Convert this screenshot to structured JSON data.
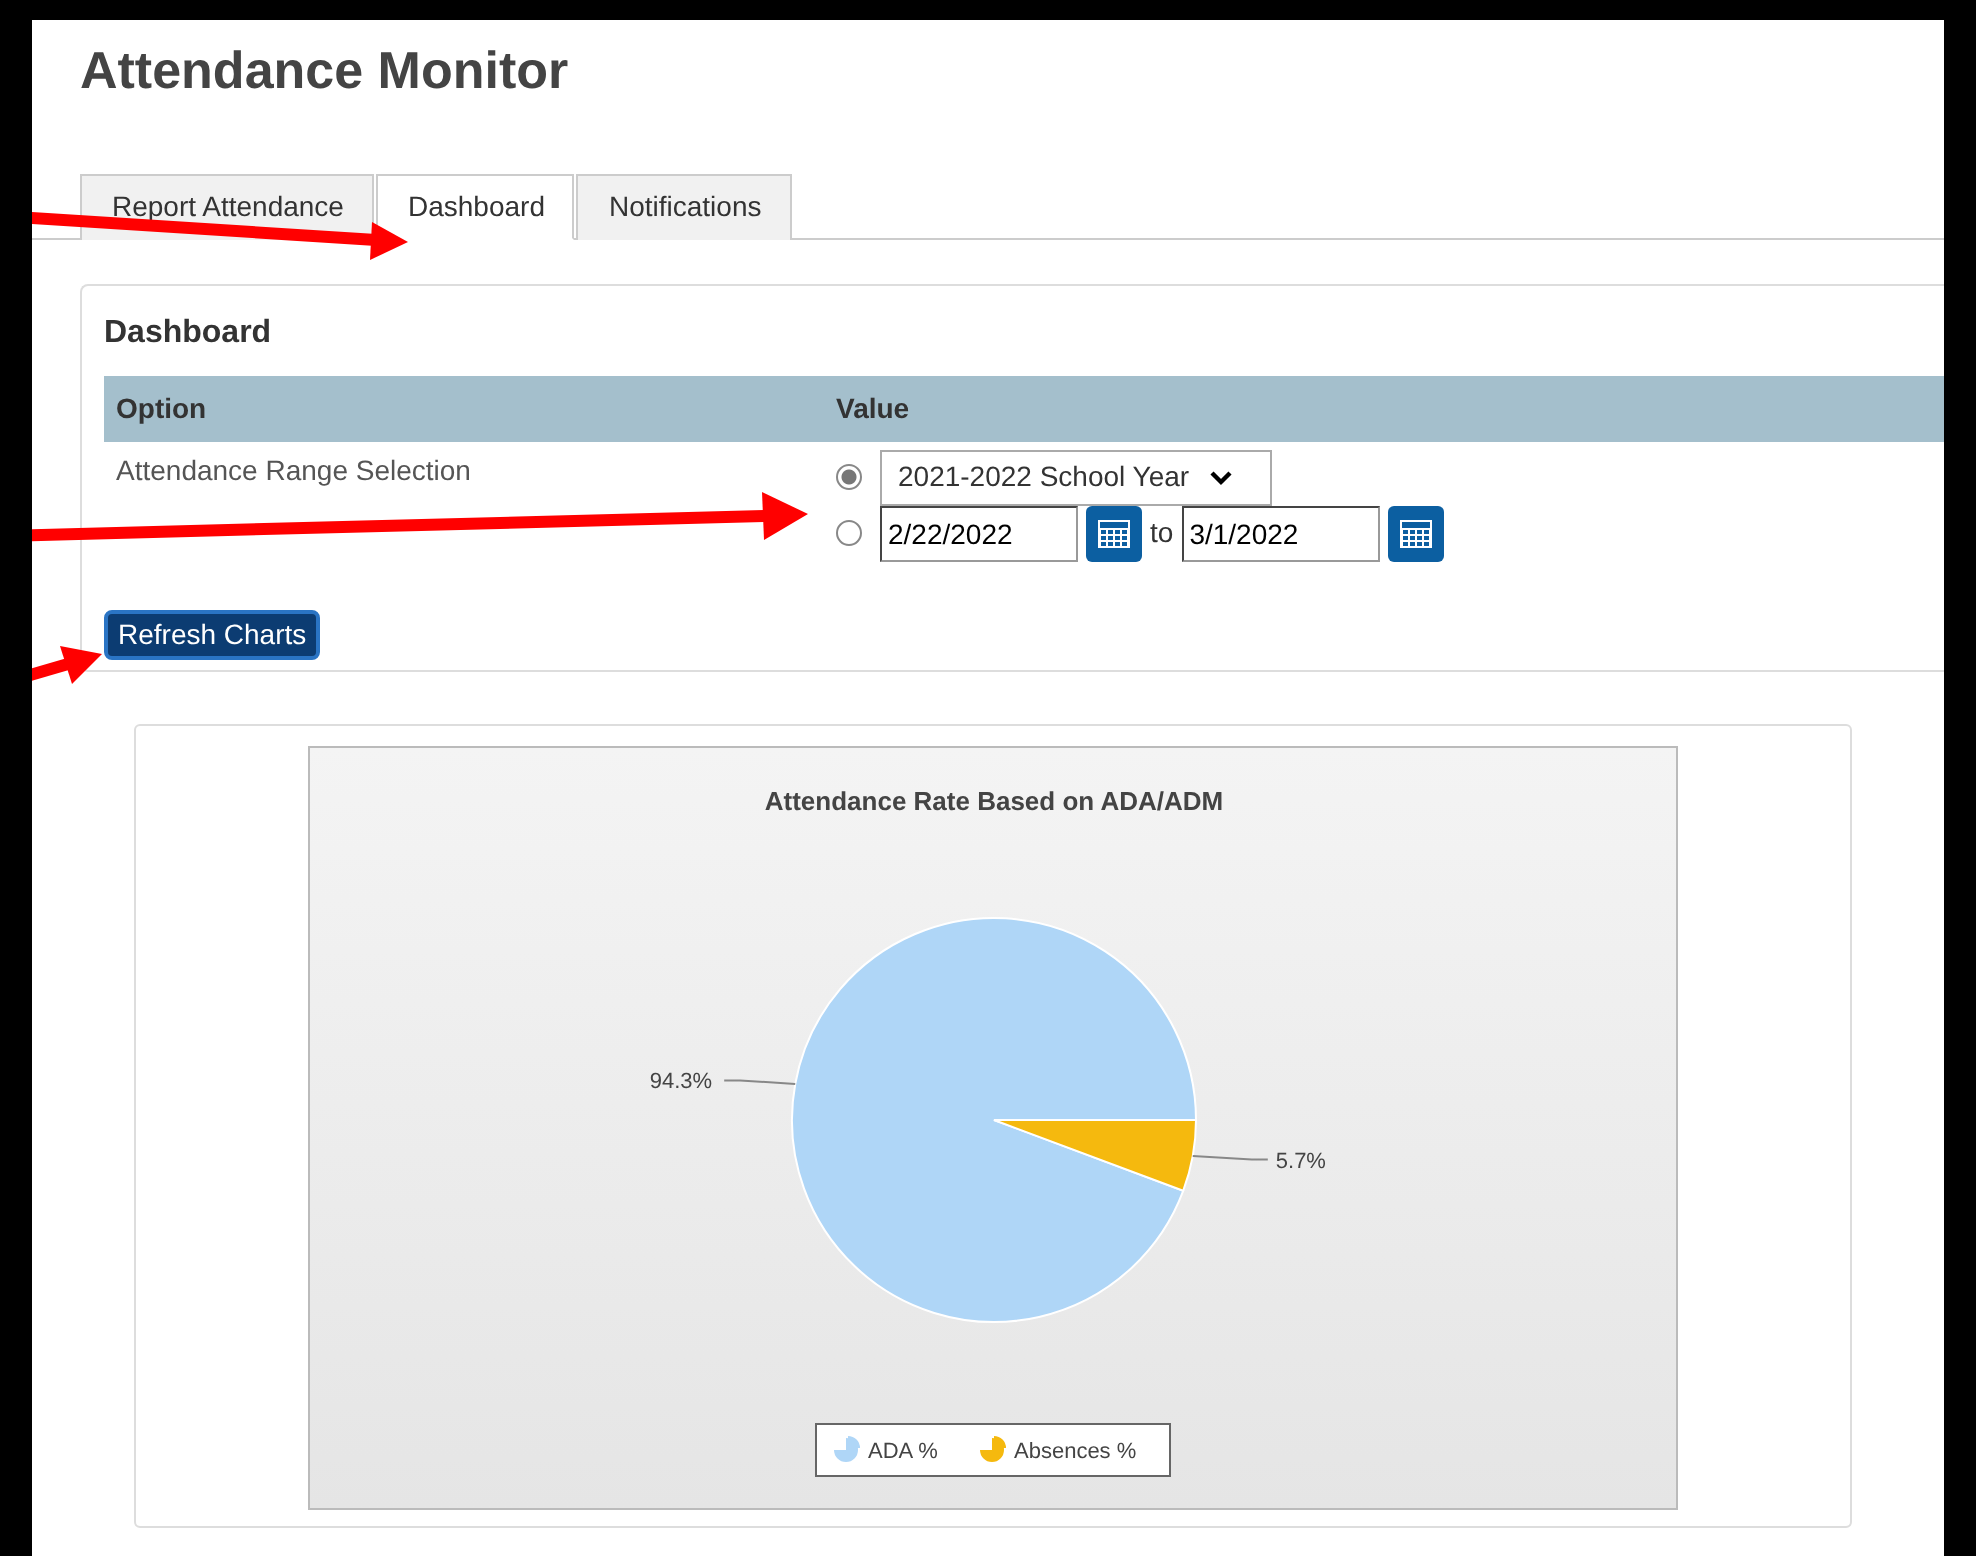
{
  "page": {
    "title": "Attendance Monitor"
  },
  "tabs": [
    {
      "label": "Report Attendance",
      "selected": false
    },
    {
      "label": "Dashboard",
      "selected": true
    },
    {
      "label": "Notifications",
      "selected": false
    }
  ],
  "panel": {
    "title": "Dashboard",
    "columns": [
      "Option",
      "Value"
    ],
    "option_label": "Attendance Range Selection",
    "ranges": [
      {
        "kind": "select",
        "selected": true,
        "value": "2021-2022 School Year"
      },
      {
        "kind": "dates",
        "selected": false,
        "from": "2/22/2022",
        "separator": "to",
        "to": "3/1/2022"
      }
    ],
    "button": "Refresh Charts"
  },
  "chart": {
    "chart_data": {
      "type": "pie",
      "title": "Attendance Rate Based on ADA/ADM",
      "categories": [
        "ADA %",
        "Absences %"
      ],
      "values": [
        94.3,
        5.7
      ],
      "colors": [
        "#afd6f7",
        "#f5b90e"
      ],
      "value_labels": [
        "94.3%",
        "5.7%"
      ],
      "legend": true
    }
  }
}
